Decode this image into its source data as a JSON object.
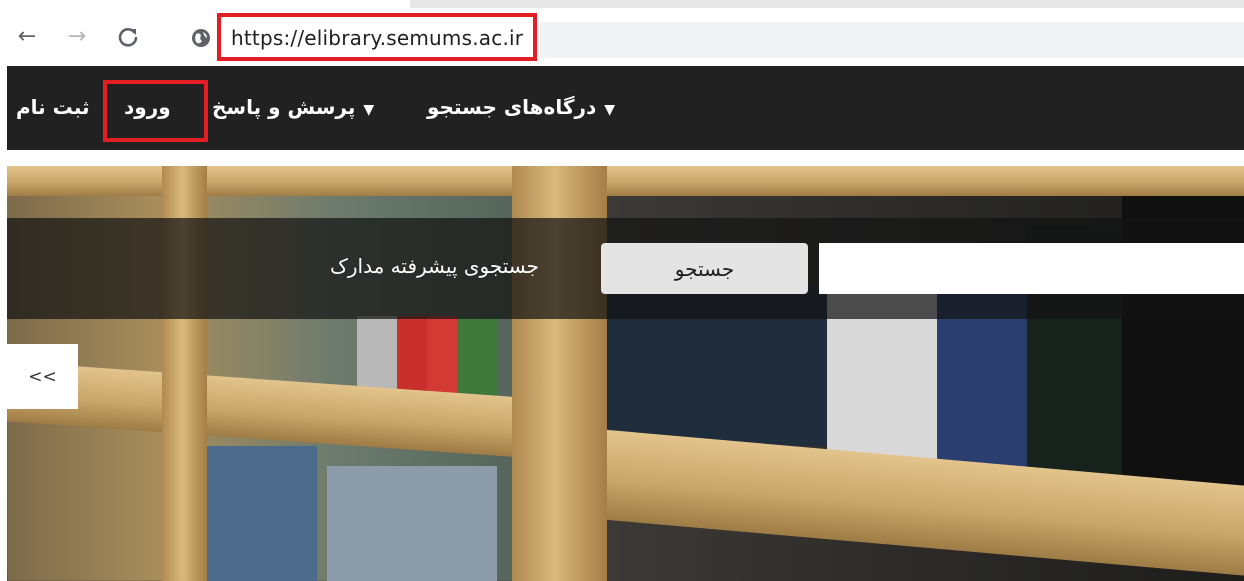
{
  "browser": {
    "url": "https://elibrary.semums.ac.ir",
    "back_glyph": "←",
    "forward_glyph": "→",
    "reload_glyph": "C",
    "highlight_color": "#e31e24"
  },
  "site_nav": {
    "background": "#212121",
    "items": [
      {
        "label": "ثبت نام"
      },
      {
        "label": "ورود"
      },
      {
        "label": "پرسش و پاسخ",
        "caret": "▼"
      },
      {
        "label": "درگاه‌های جستجو",
        "caret": "▼"
      }
    ]
  },
  "search": {
    "input_value": "",
    "button_label": "جستجو",
    "advanced_label": "جستجوی پیشرفته مدارک"
  },
  "side_toggle": {
    "label": "<<"
  },
  "icons": {
    "back": "arrow-left-icon",
    "forward": "arrow-right-icon",
    "reload": "reload-icon",
    "site_info": "globe-icon",
    "dropdown": "caret-down-icon"
  }
}
